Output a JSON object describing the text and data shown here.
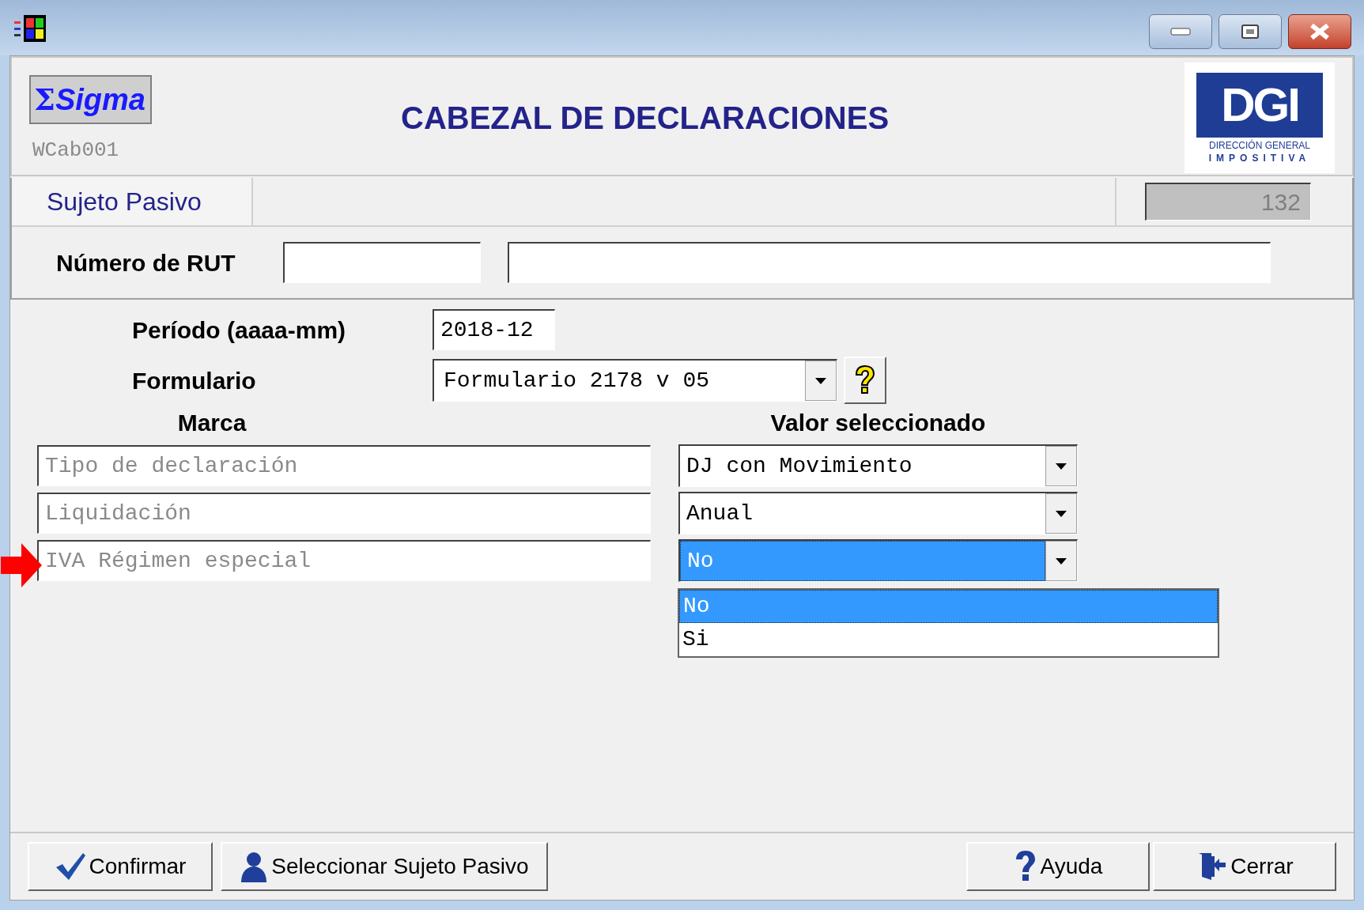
{
  "header": {
    "logo_symbol": "Σ",
    "logo": "Sigma",
    "code": "WCab001",
    "title": "CABEZAL DE DECLARACIONES",
    "agency_logo": {
      "letters": "DGI",
      "line_1": "DIRECCIÓN GENERAL",
      "line_2": "IMPOSITIVA"
    }
  },
  "taxpayer": {
    "tab_label": "Sujeto Pasivo",
    "count": "132",
    "rut_label": "Número de RUT"
  },
  "period": {
    "label": "Período (aaaa-mm)",
    "value": "2018-12"
  },
  "form": {
    "label": "Formulario",
    "value": "Formulario 2178 v 05"
  },
  "marks": {
    "heading_mark": "Marca",
    "heading_value": "Valor seleccionado",
    "rows": [
      {
        "mark": "Tipo de declaración",
        "value": "DJ con Movimiento",
        "selected": false,
        "pointed": false
      },
      {
        "mark": "Liquidación",
        "value": "Anual",
        "selected": false,
        "pointed": false
      },
      {
        "mark": "IVA Régimen especial",
        "value": "No",
        "selected": true,
        "pointed": true
      }
    ]
  },
  "dropdown": {
    "options": [
      {
        "label": "No",
        "selected": true
      },
      {
        "label": "Si",
        "selected": false
      }
    ]
  },
  "left_buttons": [
    {
      "label": "Confirmar",
      "kind": "check"
    },
    {
      "label": "Seleccionar Sujeto Pasivo",
      "kind": "person"
    }
  ],
  "right_buttons": [
    {
      "label": "Ayuda",
      "kind": "help"
    },
    {
      "label": "Cerrar",
      "kind": "exit"
    }
  ]
}
